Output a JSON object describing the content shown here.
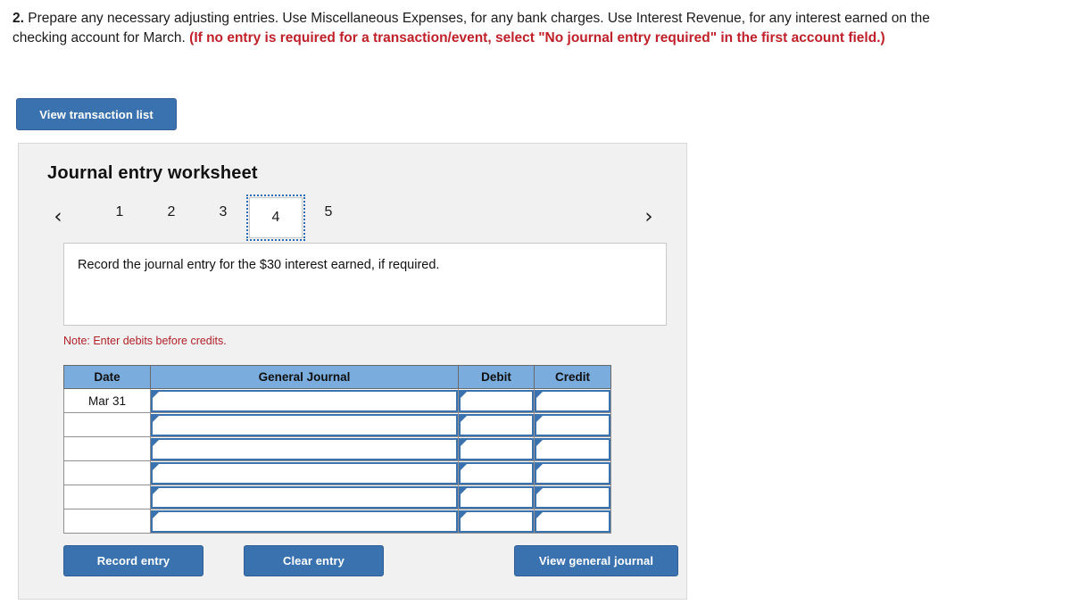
{
  "prompt": {
    "number": "2.",
    "text_main": " Prepare any necessary adjusting entries. Use Miscellaneous Expenses, for any bank charges. Use Interest Revenue, for any interest earned on the checking account for March. ",
    "text_red": "(If no entry is required for a transaction/event, select \"No journal entry required\" in the first account field.)"
  },
  "toolbar": {
    "view_transaction_list": "View transaction list"
  },
  "worksheet": {
    "title": "Journal entry worksheet",
    "prev_arrow": "‹",
    "next_arrow": "›",
    "tabs": [
      {
        "label": "1",
        "active": false
      },
      {
        "label": "2",
        "active": false
      },
      {
        "label": "3",
        "active": false
      },
      {
        "label": "4",
        "active": true
      },
      {
        "label": "5",
        "active": false
      }
    ],
    "instruction": "Record the journal entry for the $30 interest earned, if required.",
    "note": "Note: Enter debits before credits."
  },
  "table": {
    "headers": [
      "Date",
      "General Journal",
      "Debit",
      "Credit"
    ],
    "rows": [
      {
        "date": "Mar 31",
        "general_journal": "",
        "debit": "",
        "credit": ""
      },
      {
        "date": "",
        "general_journal": "",
        "debit": "",
        "credit": ""
      },
      {
        "date": "",
        "general_journal": "",
        "debit": "",
        "credit": ""
      },
      {
        "date": "",
        "general_journal": "",
        "debit": "",
        "credit": ""
      },
      {
        "date": "",
        "general_journal": "",
        "debit": "",
        "credit": ""
      },
      {
        "date": "",
        "general_journal": "",
        "debit": "",
        "credit": ""
      }
    ]
  },
  "actions": {
    "record_entry": "Record entry",
    "clear_entry": "Clear entry",
    "view_general_journal": "View general journal"
  },
  "colors": {
    "button_blue": "#3a72b0",
    "header_blue": "#7aadde",
    "alert_red": "#b02029",
    "panel_bg": "#f1f1f1",
    "cell_border_blue": "#3a72b0"
  }
}
